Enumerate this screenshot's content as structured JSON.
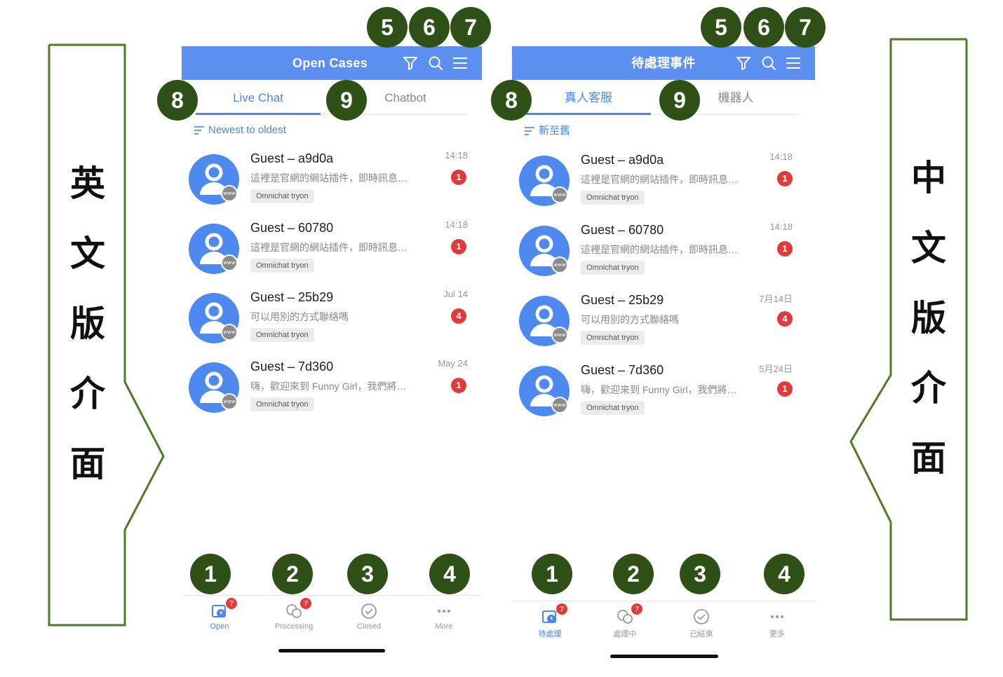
{
  "side_labels": {
    "left": [
      "英",
      "文",
      "版",
      "介",
      "面"
    ],
    "right": [
      "中",
      "文",
      "版",
      "介",
      "面"
    ]
  },
  "english": {
    "header_title": "Open Cases",
    "tabs": [
      {
        "label": "Live Chat",
        "active": true
      },
      {
        "label": "Chatbot",
        "active": false
      }
    ],
    "sort_label": "Newest to oldest",
    "conversations": [
      {
        "name": "Guest – a9d0a",
        "preview": "這裡是官網的網站插件，即時訊息…",
        "tag": "Omnichat tryon",
        "time": "14:18",
        "unread": "1"
      },
      {
        "name": "Guest – 60780",
        "preview": "這裡是官網的網站插件，即時訊息…",
        "tag": "Omnichat tryon",
        "time": "14:18",
        "unread": "1"
      },
      {
        "name": "Guest – 25b29",
        "preview": "可以用別的方式聯絡嗎",
        "tag": "Omnichat tryon",
        "time": "Jul 14",
        "unread": "4"
      },
      {
        "name": "Guest – 7d360",
        "preview": "嗨，歡迎來到 Funny Girl，我們將…",
        "tag": "Omnichat tryon",
        "time": "May 24",
        "unread": "1"
      }
    ],
    "nav": [
      {
        "label": "Open",
        "icon": "open-cases-icon",
        "badge": "7",
        "active": true
      },
      {
        "label": "Processing",
        "icon": "chat-bubbles-icon",
        "badge": "7",
        "active": false
      },
      {
        "label": "Closed",
        "icon": "check-circle-icon",
        "badge": "",
        "active": false
      },
      {
        "label": "More",
        "icon": "more-dots-icon",
        "badge": "",
        "active": false
      }
    ]
  },
  "chinese": {
    "header_title": "待處理事件",
    "tabs": [
      {
        "label": "真人客服",
        "active": true
      },
      {
        "label": "機器人",
        "active": false
      }
    ],
    "sort_label": "新至舊",
    "conversations": [
      {
        "name": "Guest – a9d0a",
        "preview": "這裡是官網的網站插件，即時訊息…",
        "tag": "Omnichat tryon",
        "time": "14:18",
        "unread": "1"
      },
      {
        "name": "Guest – 60780",
        "preview": "這裡是官網的網站插件，即時訊息…",
        "tag": "Omnichat tryon",
        "time": "14:18",
        "unread": "1"
      },
      {
        "name": "Guest – 25b29",
        "preview": "可以用別的方式聯絡嗎",
        "tag": "Omnichat tryon",
        "time": "7月14日",
        "unread": "4"
      },
      {
        "name": "Guest – 7d360",
        "preview": "嗨，歡迎來到 Funny Girl，我們將…",
        "tag": "Omnichat tryon",
        "time": "5月24日",
        "unread": "1"
      }
    ],
    "nav": [
      {
        "label": "待處理",
        "icon": "open-cases-icon",
        "badge": "7",
        "active": true
      },
      {
        "label": "處理中",
        "icon": "chat-bubbles-icon",
        "badge": "7",
        "active": false
      },
      {
        "label": "已結束",
        "icon": "check-circle-icon",
        "badge": "",
        "active": false
      },
      {
        "label": "更多",
        "icon": "more-dots-icon",
        "badge": "",
        "active": false
      }
    ]
  },
  "avatar_badge_text": "www",
  "markers": [
    "1",
    "2",
    "3",
    "4",
    "5",
    "6",
    "7",
    "8",
    "9"
  ],
  "colors": {
    "header_blue": "#5b8ff0",
    "accent_blue": "#4a86f0",
    "unread_red": "#e23a3a",
    "marker_green": "#2f5016",
    "frame_green": "#4f7a28"
  }
}
